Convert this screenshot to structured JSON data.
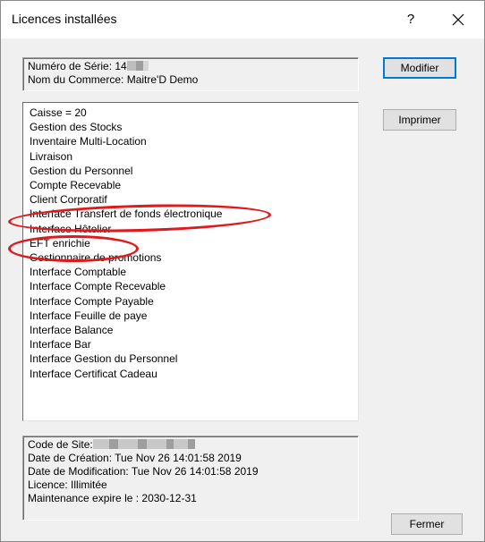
{
  "window": {
    "title": "Licences installées",
    "help_glyph": "?",
    "close_icon": "close-icon"
  },
  "info": {
    "serial_label": "Numéro de Série: 14",
    "store_line": "Nom du Commerce: Maitre'D Demo"
  },
  "licenses": [
    "Caisse = 20",
    "Gestion des Stocks",
    "Inventaire Multi-Location",
    "Livraison",
    "Gestion du Personnel",
    "Compte Recevable",
    "Client Corporatif",
    "Interface Transfert de fonds électronique",
    "Interface Hôtelier",
    "EFT enrichie",
    "Gestionnaire de promotions",
    "Interface Comptable",
    "Interface Compte Recevable",
    "Interface Compte Payable",
    "Interface Feuille de paye",
    "Interface Balance",
    "Interface Bar",
    "Interface Gestion du Personnel",
    "Interface Certificat Cadeau"
  ],
  "site": {
    "site_code_label": "Code de Site:",
    "created": "Date de Création: Tue Nov 26 14:01:58 2019",
    "modified": "Date de Modification: Tue Nov 26 14:01:58 2019",
    "license": "Licence: Illimitée",
    "maintenance": "Maintenance expire le : 2030-12-31"
  },
  "buttons": {
    "modify": "Modifier",
    "print": "Imprimer",
    "close": "Fermer"
  },
  "colors": {
    "annotation": "#e0191d",
    "focus_border": "#0078d7"
  }
}
